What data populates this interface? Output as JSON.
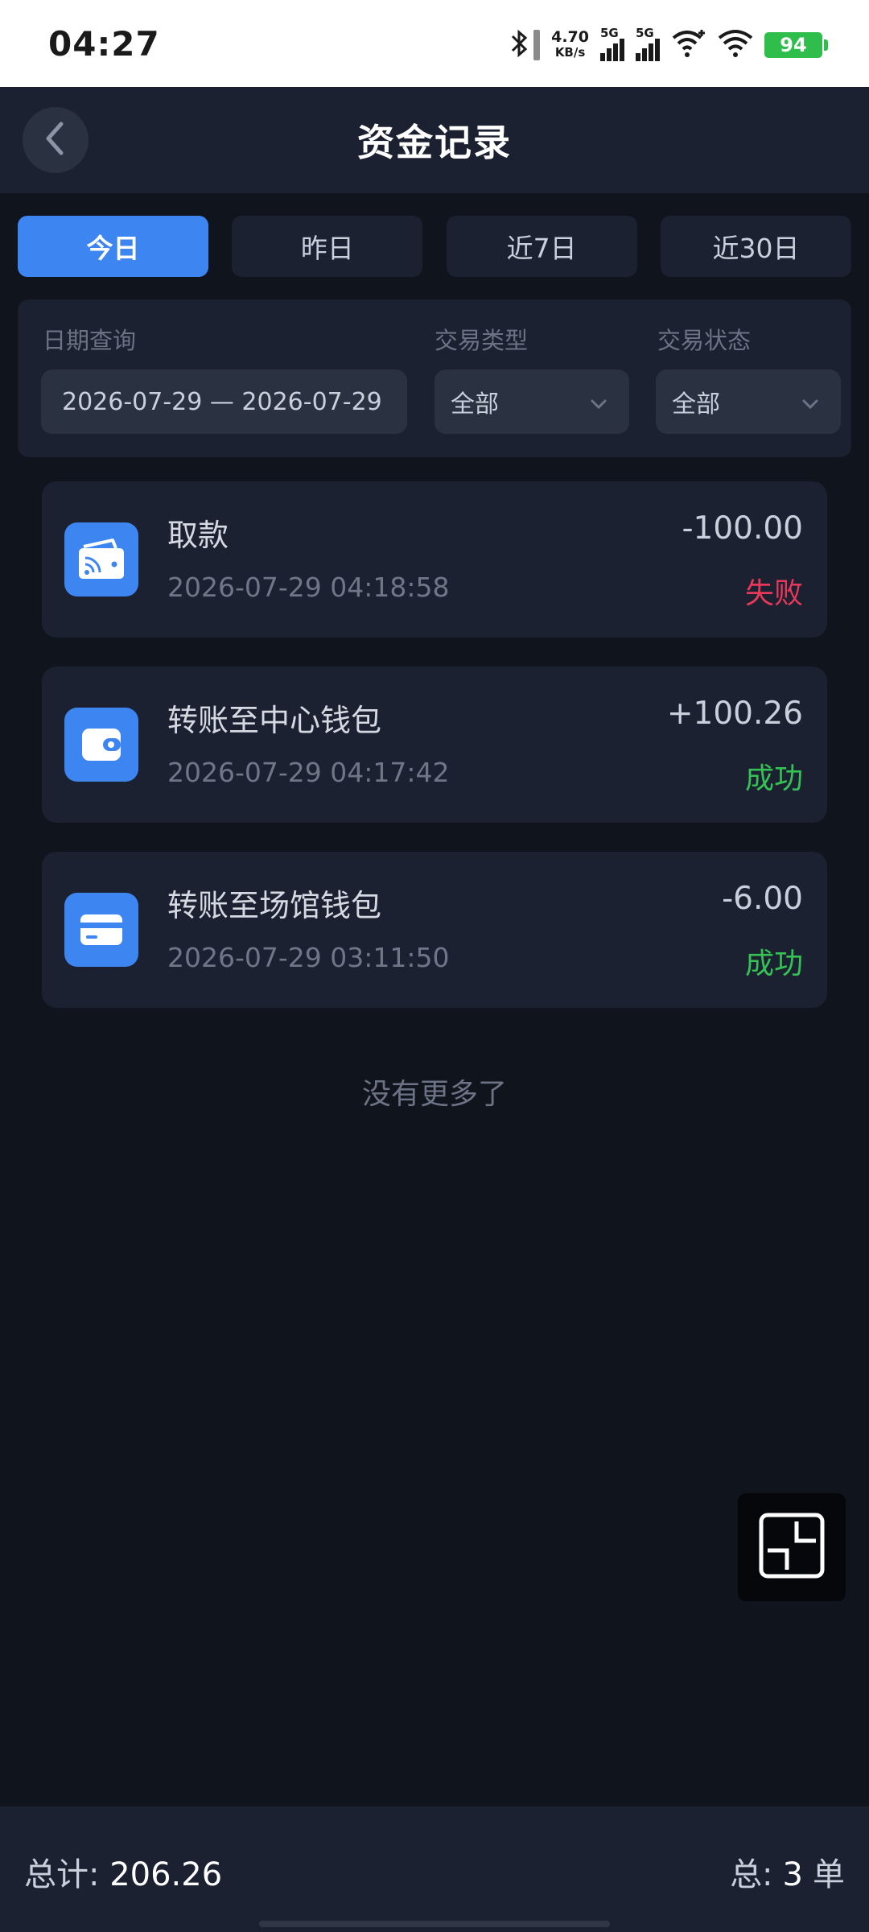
{
  "status_bar": {
    "time": "04:27",
    "net_speed_value": "4.70",
    "net_speed_unit": "KB/s",
    "signal1_label": "5G",
    "signal2_label": "5G",
    "battery": "94",
    "icons": [
      "bluetooth-icon",
      "signal-icon",
      "signal-icon",
      "wifi-plus-icon",
      "wifi-icon",
      "battery-icon"
    ]
  },
  "header": {
    "title": "资金记录",
    "back_icon": "chevron-left-icon"
  },
  "tabs": [
    {
      "label": "今日",
      "active": true
    },
    {
      "label": "昨日",
      "active": false
    },
    {
      "label": "近7日",
      "active": false
    },
    {
      "label": "近30日",
      "active": false
    }
  ],
  "filters": {
    "date_label": "日期查询",
    "date_value": "2026-07-29 — 2026-07-29",
    "type_label": "交易类型",
    "type_value": "全部",
    "status_label": "交易状态",
    "status_value": "全部"
  },
  "records": [
    {
      "title": "取款",
      "time": "2026-07-29 04:18:58",
      "amount": "-100.00",
      "status": "失败",
      "icon": "wallet-card-icon"
    },
    {
      "title": "转账至中心钱包",
      "time": "2026-07-29 04:17:42",
      "amount": "+100.26",
      "status": "成功",
      "icon": "wallet-icon"
    },
    {
      "title": "转账至场馆钱包",
      "time": "2026-07-29 03:11:50",
      "amount": "-6.00",
      "status": "成功",
      "icon": "card-icon"
    }
  ],
  "no_more": "没有更多了",
  "footer": {
    "total_label": "总计: ",
    "total_value": "206.26",
    "count_label": "总:",
    "count_value": "3",
    "count_unit": "单"
  },
  "colors": {
    "accent": "#3d86f2",
    "fail": "#e8385a",
    "success": "#35c255",
    "background": "#10141d",
    "card": "#1b2130"
  }
}
